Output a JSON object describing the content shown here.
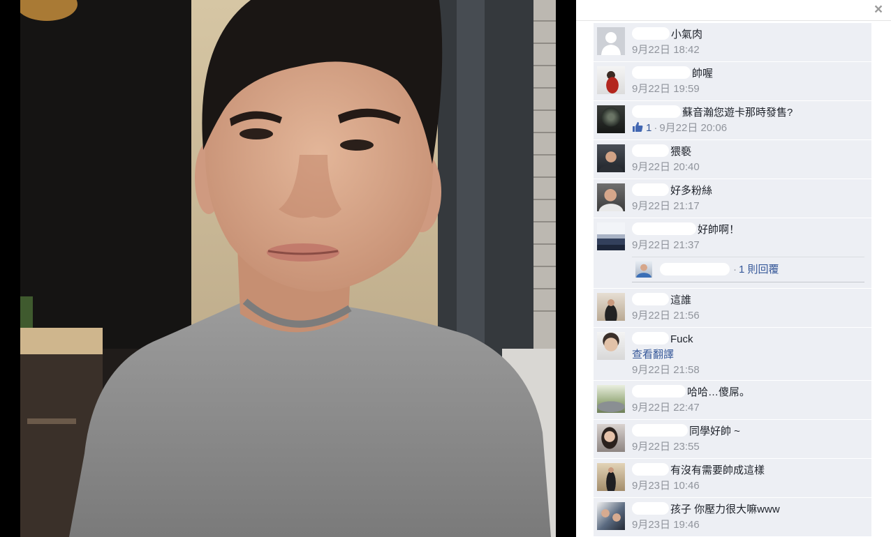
{
  "viewer": {
    "close_label": "×",
    "close_icon": "close-icon"
  },
  "comments": [
    {
      "text": "小氣肉",
      "time": "9月22日 18:42"
    },
    {
      "text": "帥喔",
      "time": "9月22日 19:59"
    },
    {
      "text": "蘇音瀚您遊卡那時發售?",
      "like_icon": "thumbs-up-icon",
      "likes": "1",
      "separator": "·",
      "time": "9月22日 20:06"
    },
    {
      "text": "猥褻",
      "time": "9月22日 20:40"
    },
    {
      "text": "好多粉絲",
      "time": "9月22日 21:17"
    },
    {
      "text": "好帥啊！",
      "time": "9月22日 21:37",
      "reply": {
        "separator": "·",
        "label": "1 則回覆"
      }
    },
    {
      "text": "這誰",
      "time": "9月22日 21:56"
    },
    {
      "text": "Fuck",
      "translate_link": "查看翻譯",
      "time": "9月22日 21:58"
    },
    {
      "text": "哈哈…傻屌。",
      "time": "9月22日 22:47"
    },
    {
      "text": "同學好帥 ~",
      "time": "9月22日 23:55"
    },
    {
      "text": "有沒有需要帥成這樣",
      "time": "9月23日 10:46"
    },
    {
      "text": "孩子 你壓力很大嘛www",
      "time": "9月23日 19:46"
    }
  ],
  "colors": {
    "text": "#1d2129",
    "time": "#90949c",
    "link": "#365899",
    "row_background": "#edeff4",
    "like": "#4267b2"
  }
}
